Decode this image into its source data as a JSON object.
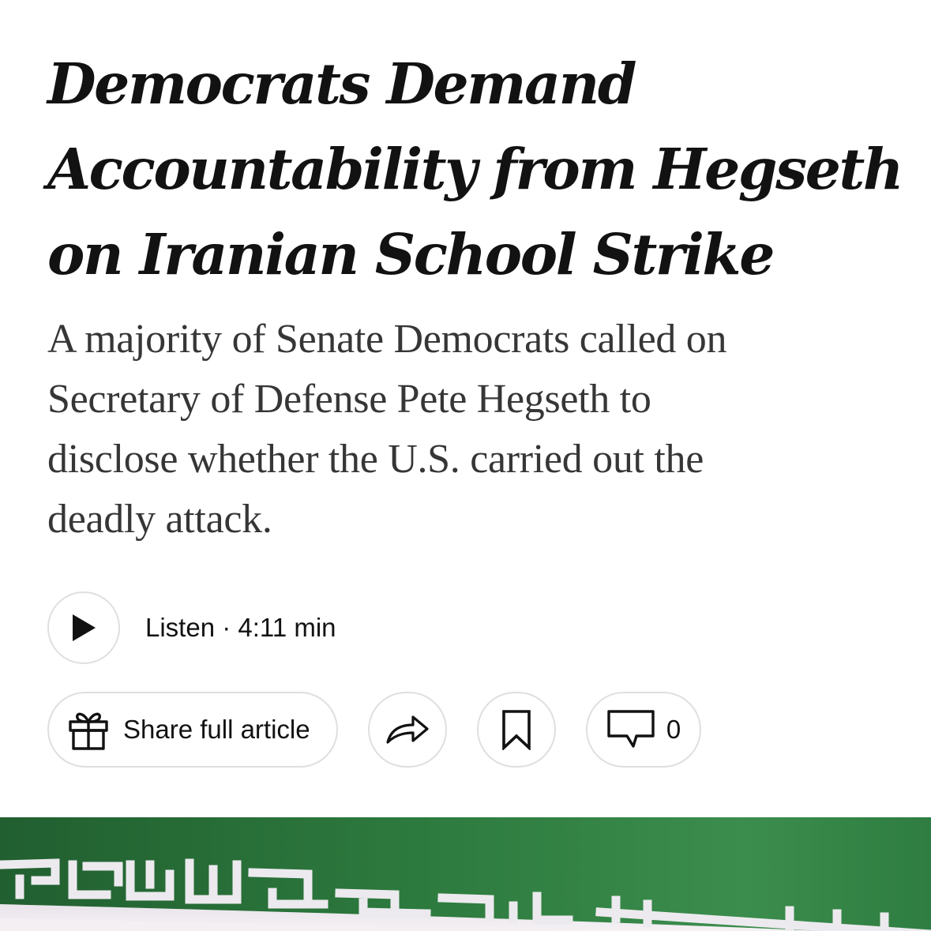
{
  "article": {
    "headline_lines": [
      "Democrats Demand",
      "Accountability from Hegseth",
      "on Iranian School Strike"
    ],
    "summary_lines": [
      "A majority of Senate Democrats called on",
      "Secretary of Defense Pete Hegseth to",
      "disclose whether the U.S. carried out the",
      "deadly attack."
    ]
  },
  "audio": {
    "listen_label": "Listen",
    "separator": " · ",
    "duration": "4:11 min"
  },
  "actions": {
    "share_full_label": "Share full article",
    "comment_count": "0"
  },
  "colors": {
    "text_primary": "#121212",
    "text_summary": "#363636",
    "border": "#dfdfdf",
    "flag_green": "#2f7a40",
    "flag_white": "#f4f1f4"
  },
  "icons": {
    "play": "play-icon",
    "gift": "gift-icon",
    "share": "share-arrow-icon",
    "bookmark": "bookmark-icon",
    "comment": "comment-bubble-icon"
  }
}
